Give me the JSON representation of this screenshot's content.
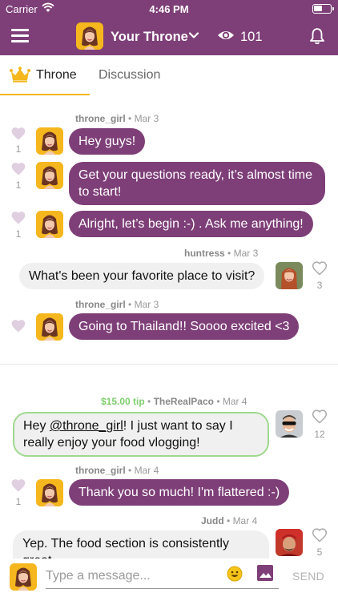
{
  "status_bar": {
    "carrier": "Carrier",
    "time": "4:46 PM"
  },
  "header": {
    "title": "Your Throne",
    "viewer_count": "101"
  },
  "tabs": [
    {
      "label": "Throne",
      "active": true
    },
    {
      "label": "Discussion",
      "active": false
    }
  ],
  "messages": [
    {
      "sender": "throne_girl",
      "date": "Mar 3",
      "text": "Hey guys!",
      "likes": "1",
      "align": "left"
    },
    {
      "text": "Get your questions ready, it’s almost time to start!",
      "likes": "1",
      "align": "left"
    },
    {
      "text": "Alright, let’s begin :-) . Ask me anything!",
      "likes": "1",
      "align": "left"
    },
    {
      "sender": "huntress",
      "date": "Mar 3",
      "text": "What's been your favorite place to visit?",
      "likes": "3",
      "align": "right"
    },
    {
      "sender": "throne_girl",
      "date": "Mar 3",
      "text": "Going to Thailand!! Soooo excited <3",
      "likes": "",
      "align": "left"
    },
    {
      "tip": "$15.00 tip",
      "sender": "TheRealPaco",
      "date": "Mar 4",
      "text_before": "Hey ",
      "mention": "@throne_girl",
      "text_after": "! I just want to say I really enjoy your food vlogging!",
      "likes": "12",
      "align": "right"
    },
    {
      "sender": "throne_girl",
      "date": "Mar 4",
      "text": "Thank you so much! I'm flattered :-)",
      "likes": "1",
      "align": "left"
    },
    {
      "sender": "Judd",
      "date": "Mar 4",
      "text": "Yep. The food section is consistently great.",
      "likes": "5",
      "align": "right"
    }
  ],
  "meta_separator": "•",
  "composer": {
    "placeholder": "Type a message...",
    "send_label": "SEND"
  },
  "colors": {
    "brand": "#7e3f78",
    "accent": "#f5b71d",
    "tip": "#7fce6e",
    "heart": "#e0cfe0"
  },
  "icons": [
    "menu-icon",
    "chevron-down-icon",
    "eye-icon",
    "bell-icon",
    "crown-icon",
    "heart-icon",
    "emoji-icon",
    "image-icon",
    "wifi-icon",
    "battery-icon"
  ]
}
